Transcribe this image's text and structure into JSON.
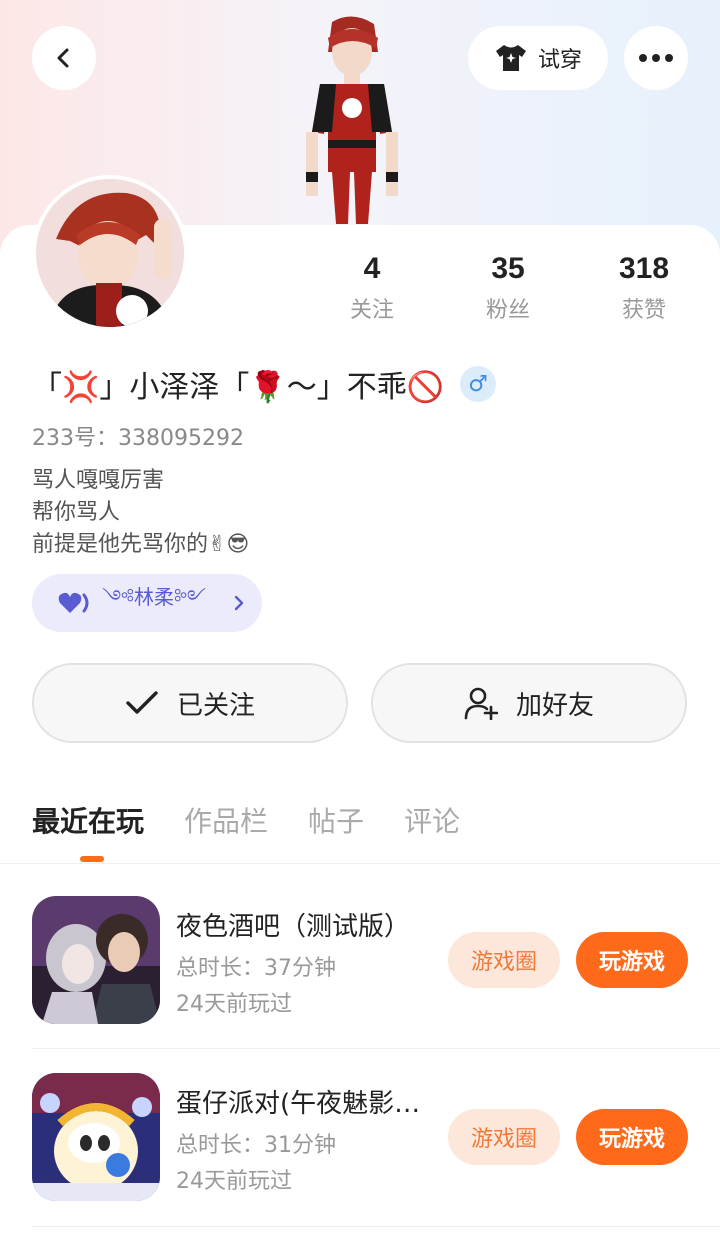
{
  "header": {
    "tryon_label": "试穿"
  },
  "stats": [
    {
      "value": "4",
      "label": "关注"
    },
    {
      "value": "35",
      "label": "粉丝"
    },
    {
      "value": "318",
      "label": "获赞"
    }
  ],
  "profile": {
    "nickname": "「💢」小泽泽「🌹～」不乖🚫",
    "gender_symbol": "♂",
    "uid": "233号：338095292",
    "bio_lines": [
      "骂人嘎嘎厉害",
      "帮你骂人",
      "前提是他先骂你的✌😎"
    ],
    "guard_name": "༺林柔༻"
  },
  "actions": {
    "followed_label": "已关注",
    "add_friend_label": "加好友"
  },
  "tabs": [
    "最近在玩",
    "作品栏",
    "帖子",
    "评论"
  ],
  "games": [
    {
      "title": "夜色酒吧（测试版）",
      "duration": "总时长：37分钟",
      "last_played": "24天前玩过",
      "circle_label": "游戏圈",
      "play_label": "玩游戏"
    },
    {
      "title": "蛋仔派对(午夜魅影…",
      "duration": "总时长：31分钟",
      "last_played": "24天前玩过",
      "circle_label": "游戏圈",
      "play_label": "玩游戏"
    }
  ],
  "colors": {
    "accent": "#ff6a1a",
    "accent_soft": "#fde7da",
    "guard_bg": "#ebebfb",
    "guard_text": "#5a5bd3"
  }
}
